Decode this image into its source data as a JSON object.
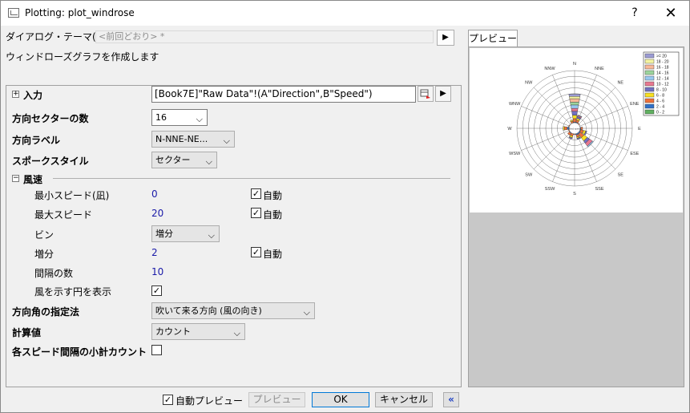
{
  "window": {
    "title": "Plotting: plot_windrose",
    "help": "?",
    "close": "✕"
  },
  "theme": {
    "label": "ダイアログ・テーマ(H)",
    "value": "<前回どおり> *",
    "arrow": "▶"
  },
  "description": "ウィンドローズグラフを作成します",
  "input": {
    "toggle": "+",
    "label": "入力",
    "value": "[Book7E]\"Raw Data\"!(A\"Direction\",B\"Speed\")",
    "arrow": "▶"
  },
  "sectors": {
    "label": "方向セクターの数",
    "value": "16"
  },
  "dir_label": {
    "label": "方向ラベル",
    "value": "N-NNE-NE..."
  },
  "spoke": {
    "label": "スポークスタイル",
    "value": "セクター"
  },
  "wind": {
    "toggle": "−",
    "label": "風速",
    "min_label": "最小スピード(凪)",
    "min_value": "0",
    "min_auto": "自動",
    "max_label": "最大スピード",
    "max_value": "20",
    "max_auto": "自動",
    "bin_label": "ビン",
    "bin_value": "増分",
    "inc_label": "増分",
    "inc_value": "2",
    "inc_auto": "自動",
    "count_label": "間隔の数",
    "count_value": "10",
    "circle_label": "風を示す円を表示"
  },
  "angle": {
    "label": "方向角の指定法",
    "value": "吹いて来る方向 (風の向き)"
  },
  "calc": {
    "label": "計算値",
    "value": "カウント"
  },
  "subtotal": {
    "label": "各スピード間隔の小計カウント"
  },
  "preview_tab": "プレビュー",
  "rose": {
    "center_text": "Wind speed",
    "directions": [
      "N",
      "NNE",
      "NE",
      "ENE",
      "E",
      "ESE",
      "SE",
      "SSE",
      "S",
      "SSW",
      "SW",
      "WSW",
      "W",
      "WNW",
      "NW",
      "NNW"
    ],
    "legend": [
      {
        "label": ">= 20",
        "color": "#9c9cd4"
      },
      {
        "label": "18 - 20",
        "color": "#f4f4a0"
      },
      {
        "label": "16 - 18",
        "color": "#f8b898"
      },
      {
        "label": "14 - 16",
        "color": "#9cd49c"
      },
      {
        "label": "12 - 14",
        "color": "#98c8f0"
      },
      {
        "label": "10 - 12",
        "color": "#e87890"
      },
      {
        "label": "8 - 10",
        "color": "#7070c0"
      },
      {
        "label": "6 - 8",
        "color": "#f8e020"
      },
      {
        "label": "4 - 6",
        "color": "#f07038"
      },
      {
        "label": "2 - 4",
        "color": "#3070c8"
      },
      {
        "label": "0 - 2",
        "color": "#60b060"
      }
    ],
    "sectors": [
      [
        0.06,
        0.05,
        0.06,
        0.06,
        0.07,
        0.05,
        0.06,
        0.05,
        0.06,
        0.04,
        0.04
      ],
      [
        0.06,
        0.05,
        0.04,
        0.03,
        0.03,
        0.02,
        0.01,
        0,
        0,
        0,
        0
      ],
      [
        0.05,
        0.04,
        0.02,
        0,
        0,
        0,
        0,
        0,
        0,
        0,
        0
      ],
      [
        0.04,
        0.03,
        0.02,
        0,
        0,
        0,
        0,
        0,
        0,
        0,
        0
      ],
      [
        0.06,
        0.05,
        0.03,
        0,
        0,
        0,
        0,
        0,
        0,
        0,
        0
      ],
      [
        0.06,
        0.05,
        0.05,
        0.04,
        0.02,
        0,
        0,
        0,
        0,
        0,
        0
      ],
      [
        0.06,
        0.06,
        0.08,
        0.07,
        0.05,
        0.06,
        0.02,
        0,
        0,
        0,
        0
      ],
      [
        0.06,
        0.06,
        0.04,
        0.02,
        0.02,
        0,
        0,
        0,
        0,
        0,
        0
      ],
      [
        0.05,
        0.04,
        0.02,
        0,
        0,
        0,
        0,
        0,
        0,
        0,
        0
      ],
      [
        0.05,
        0.04,
        0.05,
        0.03,
        0.02,
        0,
        0,
        0,
        0,
        0,
        0
      ],
      [
        0.06,
        0.05,
        0.04,
        0,
        0,
        0,
        0,
        0,
        0,
        0,
        0
      ],
      [
        0.05,
        0.04,
        0.02,
        0,
        0,
        0,
        0,
        0,
        0,
        0,
        0
      ],
      [
        0.06,
        0.07,
        0.05,
        0.02,
        0,
        0,
        0,
        0,
        0,
        0,
        0
      ],
      [
        0.05,
        0.04,
        0.02,
        0,
        0,
        0,
        0,
        0,
        0,
        0,
        0
      ],
      [
        0.05,
        0.03,
        0.02,
        0,
        0,
        0,
        0,
        0,
        0,
        0,
        0
      ],
      [
        0.05,
        0.05,
        0.03,
        0.02,
        0,
        0,
        0,
        0,
        0,
        0,
        0
      ]
    ]
  },
  "footer": {
    "auto_preview": "自動プレビュー",
    "preview": "プレビュー",
    "ok": "OK",
    "cancel": "キャンセル",
    "collapse": "«"
  }
}
